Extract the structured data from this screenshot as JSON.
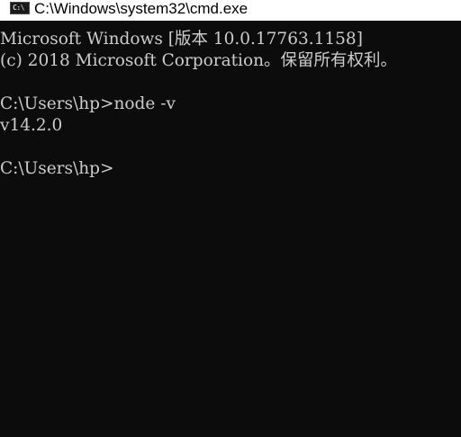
{
  "window": {
    "title": "C:\\Windows\\system32\\cmd.exe",
    "icon": "cmd-icon",
    "icon_glyph": "C:\\"
  },
  "console": {
    "lines": [
      "Microsoft Windows [版本 10.0.17763.1158]",
      "(c) 2018 Microsoft Corporation。保留所有权利。",
      "C:\\Users\\hp>node -v",
      "v14.2.0",
      "C:\\Users\\hp>"
    ]
  },
  "colors": {
    "console_background": "#0c0c0c",
    "console_text": "#cccccc",
    "titlebar_background": "#ffffff"
  }
}
